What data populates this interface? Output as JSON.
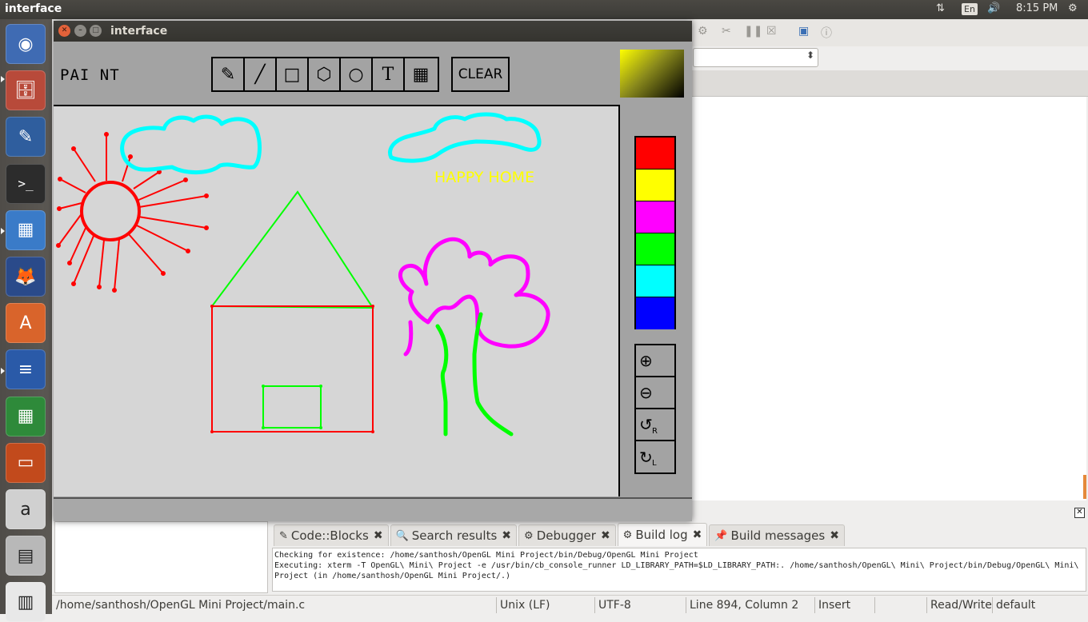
{
  "top_panel": {
    "active_title": "interface",
    "keyboard_layout": "En",
    "clock": "8:15 PM"
  },
  "launcher": {
    "items": [
      {
        "name": "ubuntu-dash",
        "icon": "ubuntu-logo-icon",
        "color": "#3f6bb3"
      },
      {
        "name": "files",
        "icon": "file-cabinet-icon",
        "color": "#b84a3a"
      },
      {
        "name": "text-editor",
        "icon": "text-editor-icon",
        "color": "#2f5e9e"
      },
      {
        "name": "terminal",
        "icon": "terminal-icon",
        "color": "#2c2c2c"
      },
      {
        "name": "codeblocks",
        "icon": "codeblocks-icon",
        "color": "#3a7bc8"
      },
      {
        "name": "firefox",
        "icon": "firefox-icon",
        "color": "#2a4a8a"
      },
      {
        "name": "software-center",
        "icon": "software-center-icon",
        "color": "#d9642b"
      },
      {
        "name": "libreoffice-writer",
        "icon": "writer-icon",
        "color": "#2a5aa8"
      },
      {
        "name": "libreoffice-calc",
        "icon": "calc-icon",
        "color": "#2e8a3a"
      },
      {
        "name": "libreoffice-impress",
        "icon": "impress-icon",
        "color": "#c24a1c"
      },
      {
        "name": "amazon",
        "icon": "amazon-icon",
        "color": "#d0d0d0"
      },
      {
        "name": "xterm",
        "icon": "xterm-icon",
        "color": "#b8b8b8"
      },
      {
        "name": "workspaces",
        "icon": "workspace-switcher-icon",
        "color": "#e8e8e8"
      }
    ]
  },
  "paint_window": {
    "title": "interface",
    "app_label": "PAI NT",
    "tools": [
      {
        "name": "pencil",
        "glyph": "✎"
      },
      {
        "name": "line",
        "glyph": "╱"
      },
      {
        "name": "rectangle",
        "glyph": "□"
      },
      {
        "name": "polygon",
        "glyph": "⬡"
      },
      {
        "name": "circle",
        "glyph": "○"
      },
      {
        "name": "text",
        "glyph": "T"
      },
      {
        "name": "grid",
        "glyph": "▦"
      }
    ],
    "clear_label": "CLEAR",
    "canvas_text": "HAPPY HOME",
    "palette": [
      {
        "name": "red",
        "color": "#ff0000"
      },
      {
        "name": "yellow",
        "color": "#ffff00"
      },
      {
        "name": "magenta",
        "color": "#ff00ff"
      },
      {
        "name": "green",
        "color": "#00ff00"
      },
      {
        "name": "cyan",
        "color": "#00ffff"
      },
      {
        "name": "blue",
        "color": "#0000ff"
      }
    ],
    "view_buttons": [
      {
        "name": "zoom-in",
        "glyph": "⊕",
        "sub": ""
      },
      {
        "name": "zoom-out",
        "glyph": "⊖",
        "sub": ""
      },
      {
        "name": "rotate-right",
        "glyph": "↺",
        "sub": "R"
      },
      {
        "name": "rotate-left",
        "glyph": "↻",
        "sub": "L"
      }
    ]
  },
  "codeblocks": {
    "log_tabs": [
      {
        "label": "Code::Blocks",
        "icon": "✎",
        "active": false
      },
      {
        "label": "Search results",
        "icon": "🔍",
        "active": false
      },
      {
        "label": "Debugger",
        "icon": "⚙",
        "active": false
      },
      {
        "label": "Build log",
        "icon": "⚙",
        "active": true
      },
      {
        "label": "Build messages",
        "icon": "📌",
        "active": false
      }
    ],
    "log_lines": [
      "Checking for existence: /home/santhosh/OpenGL Mini Project/bin/Debug/OpenGL Mini Project",
      "Executing: xterm -T OpenGL\\ Mini\\ Project -e /usr/bin/cb_console_runner LD_LIBRARY_PATH=$LD_LIBRARY_PATH:. /home/santhosh/OpenGL\\ Mini\\ Project/bin/Debug/OpenGL\\ Mini\\",
      "Project  (in /home/santhosh/OpenGL Mini Project/.)"
    ],
    "status": {
      "file_path": "/home/santhosh/OpenGL Mini Project/main.c",
      "line_endings": "Unix (LF)",
      "encoding": "UTF-8",
      "position": "Line 894, Column 2",
      "mode": "Insert",
      "access": "Read/Write",
      "lang": "default"
    }
  }
}
